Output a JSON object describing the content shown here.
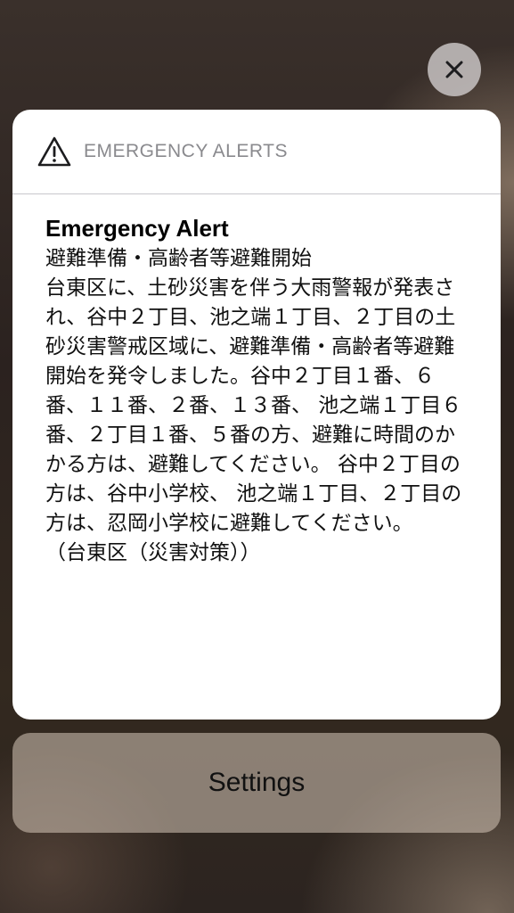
{
  "alert_card": {
    "header_label": "EMERGENCY ALERTS",
    "title": "Emergency Alert",
    "message": "避難準備・高齢者等避難開始\n 台東区に、土砂災害を伴う大雨警報が発表され、谷中２丁目、池之端１丁目、２丁目の土砂災害警戒区域に、避難準備・高齢者等避難開始を発令しました。谷中２丁目１番、６番、１１番、２番、１３番、 池之端１丁目６番、２丁目１番、５番の方、避難に時間のかかる方は、避難してください。 谷中２丁目の方は、谷中小学校、 池之端１丁目、２丁目の方は、忍岡小学校に避難してください。\n（台東区（災害対策））"
  },
  "settings_button": {
    "label": "Settings"
  },
  "icons": {
    "close": "close-icon",
    "warning": "warning-triangle-icon"
  }
}
